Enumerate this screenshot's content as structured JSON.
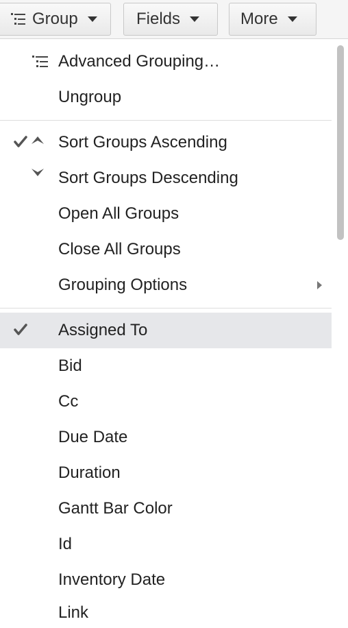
{
  "toolbar": {
    "group_label": "Group",
    "fields_label": "Fields",
    "more_label": "More"
  },
  "menu": {
    "advanced_grouping": "Advanced Grouping…",
    "ungroup": "Ungroup",
    "sort_ascending": "Sort Groups Ascending",
    "sort_descending": "Sort Groups Descending",
    "open_all": "Open All Groups",
    "close_all": "Close All Groups",
    "grouping_options": "Grouping Options",
    "fields": [
      {
        "label": "Assigned To",
        "checked": true
      },
      {
        "label": "Bid",
        "checked": false
      },
      {
        "label": "Cc",
        "checked": false
      },
      {
        "label": "Due Date",
        "checked": false
      },
      {
        "label": "Duration",
        "checked": false
      },
      {
        "label": "Gantt Bar Color",
        "checked": false
      },
      {
        "label": "Id",
        "checked": false
      },
      {
        "label": "Inventory Date",
        "checked": false
      },
      {
        "label": "Link",
        "checked": false
      }
    ]
  },
  "state": {
    "sort_ascending_checked": true
  },
  "colors": {
    "highlight": "#e6e7ea",
    "text": "#222222",
    "icon": "#555555"
  },
  "icons": {
    "group": "group-tree-icon",
    "check": "checkmark-icon",
    "ascending": "chevron-up-icon",
    "descending": "chevron-down-icon",
    "submenu": "submenu-arrow-icon"
  }
}
